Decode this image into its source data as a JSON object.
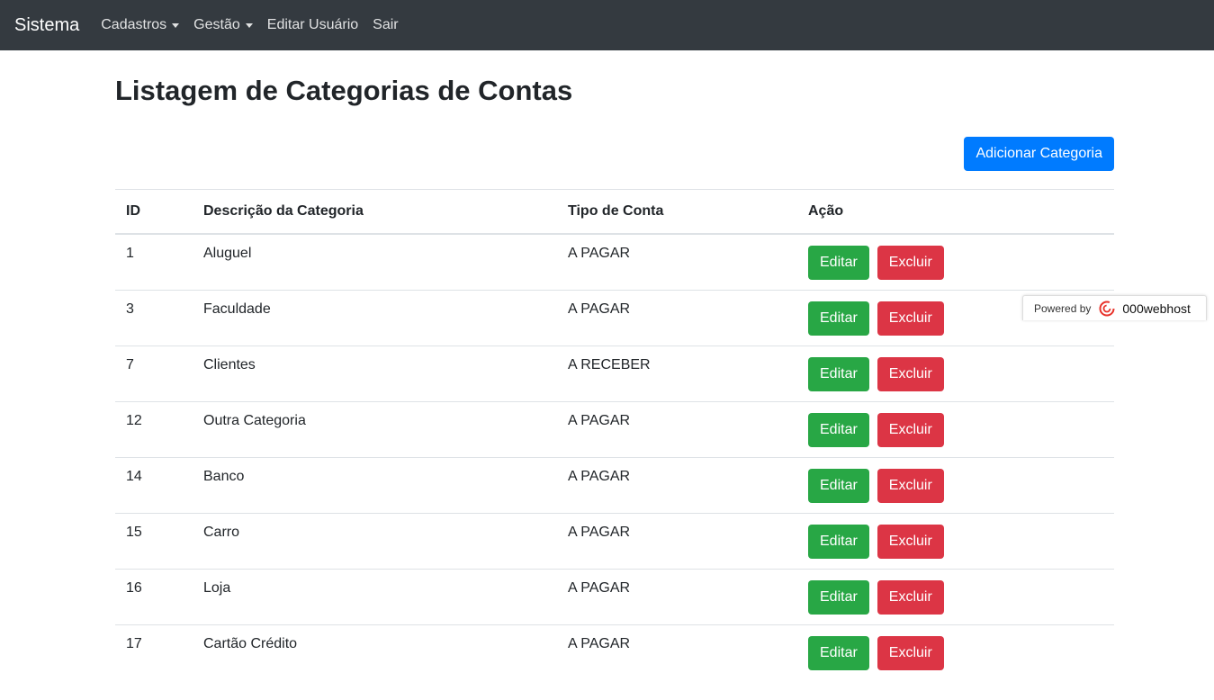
{
  "navbar": {
    "brand": "Sistema",
    "items": [
      {
        "label": "Cadastros",
        "dropdown": true
      },
      {
        "label": "Gestão",
        "dropdown": true
      },
      {
        "label": "Editar Usuário",
        "dropdown": false
      },
      {
        "label": "Sair",
        "dropdown": false
      }
    ]
  },
  "page": {
    "title": "Listagem de Categorias de Contas",
    "add_button": "Adicionar Categoria"
  },
  "table": {
    "headers": [
      "ID",
      "Descrição da Categoria",
      "Tipo de Conta",
      "Ação"
    ],
    "rows": [
      {
        "id": "1",
        "descricao": "Aluguel",
        "tipo": "A PAGAR"
      },
      {
        "id": "3",
        "descricao": "Faculdade",
        "tipo": "A PAGAR"
      },
      {
        "id": "7",
        "descricao": "Clientes",
        "tipo": "A RECEBER"
      },
      {
        "id": "12",
        "descricao": "Outra Categoria",
        "tipo": "A PAGAR"
      },
      {
        "id": "14",
        "descricao": "Banco",
        "tipo": "A PAGAR"
      },
      {
        "id": "15",
        "descricao": "Carro",
        "tipo": "A PAGAR"
      },
      {
        "id": "16",
        "descricao": "Loja",
        "tipo": "A PAGAR"
      },
      {
        "id": "17",
        "descricao": "Cartão Crédito",
        "tipo": "A PAGAR"
      }
    ],
    "edit_label": "Editar",
    "delete_label": "Excluir"
  },
  "badge": {
    "powered_by": "Powered by",
    "brand": "000webhost",
    "logo_icon": "000webhost-logo-icon"
  },
  "colors": {
    "navbar_bg": "#343a40",
    "primary": "#007bff",
    "success": "#28a745",
    "danger": "#dc3545"
  }
}
